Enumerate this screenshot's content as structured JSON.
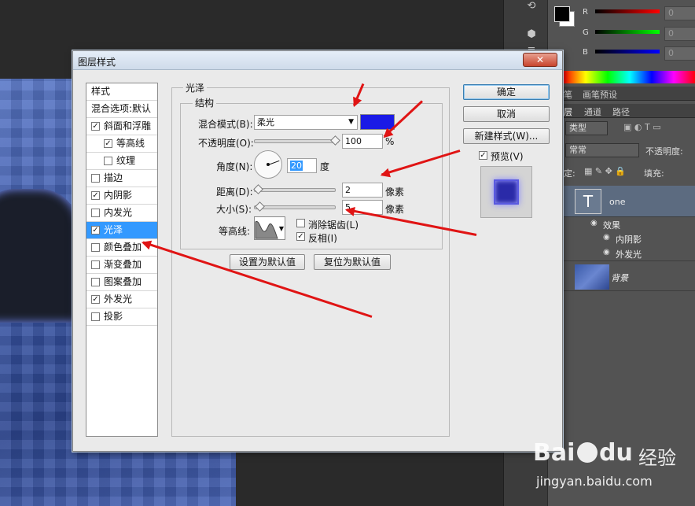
{
  "dialog": {
    "title": "图层样式",
    "close_label": "✕",
    "style_list": [
      {
        "label": "样式",
        "checkbox": null,
        "indent": 0,
        "selected": false
      },
      {
        "label": "混合选项:默认",
        "checkbox": null,
        "indent": 0,
        "selected": false
      },
      {
        "label": "斜面和浮雕",
        "checkbox": true,
        "indent": 0,
        "selected": false
      },
      {
        "label": "等高线",
        "checkbox": true,
        "indent": 1,
        "selected": false
      },
      {
        "label": "纹理",
        "checkbox": false,
        "indent": 1,
        "selected": false
      },
      {
        "label": "描边",
        "checkbox": false,
        "indent": 0,
        "selected": false
      },
      {
        "label": "内阴影",
        "checkbox": true,
        "indent": 0,
        "selected": false
      },
      {
        "label": "内发光",
        "checkbox": false,
        "indent": 0,
        "selected": false
      },
      {
        "label": "光泽",
        "checkbox": true,
        "indent": 0,
        "selected": true
      },
      {
        "label": "颜色叠加",
        "checkbox": false,
        "indent": 0,
        "selected": false
      },
      {
        "label": "渐变叠加",
        "checkbox": false,
        "indent": 0,
        "selected": false
      },
      {
        "label": "图案叠加",
        "checkbox": false,
        "indent": 0,
        "selected": false
      },
      {
        "label": "外发光",
        "checkbox": true,
        "indent": 0,
        "selected": false
      },
      {
        "label": "投影",
        "checkbox": false,
        "indent": 0,
        "selected": false
      }
    ],
    "satin": {
      "group_title": "光泽",
      "structure_title": "结构",
      "blend_mode_label": "混合模式(B):",
      "blend_mode_value": "柔光",
      "blend_color": "#1a1ae6",
      "opacity_label": "不透明度(O):",
      "opacity_value": "100",
      "opacity_unit": "%",
      "angle_label": "角度(N):",
      "angle_value": "20",
      "angle_unit": "度",
      "distance_label": "距离(D):",
      "distance_value": "2",
      "distance_unit": "像素",
      "size_label": "大小(S):",
      "size_value": "5",
      "size_unit": "像素",
      "contour_label": "等高线:",
      "antialias_label": "消除锯齿(L)",
      "antialias_checked": false,
      "invert_label": "反相(I)",
      "invert_checked": true,
      "set_default_label": "设置为默认值",
      "reset_default_label": "复位为默认值"
    },
    "buttons": {
      "ok": "确定",
      "cancel": "取消",
      "new_style": "新建样式(W)...",
      "preview_label": "预览(V)",
      "preview_checked": true
    }
  },
  "right_panel": {
    "color": {
      "channels": [
        {
          "label": "R",
          "value": "0"
        },
        {
          "label": "G",
          "value": "0"
        },
        {
          "label": "B",
          "value": "0"
        }
      ]
    },
    "top_tabs": [
      "笔",
      "画笔预设"
    ],
    "layer_tabs": [
      "层",
      "通道",
      "路径"
    ],
    "kind_label": "类型",
    "blend_mode": "常常",
    "opacity_label": "不透明度:",
    "lock_label": "定:",
    "fill_label": "填充:",
    "layers": [
      {
        "name": "one",
        "type": "text"
      },
      {
        "name": "效果",
        "type": "effects"
      },
      {
        "name": "内阴影",
        "type": "effect"
      },
      {
        "name": "外发光",
        "type": "effect"
      },
      {
        "name": "背景",
        "type": "background"
      }
    ]
  },
  "watermark": {
    "brand": "Bai",
    "brand2": "du",
    "product": "经验",
    "url": "jingyan.baidu.com"
  }
}
